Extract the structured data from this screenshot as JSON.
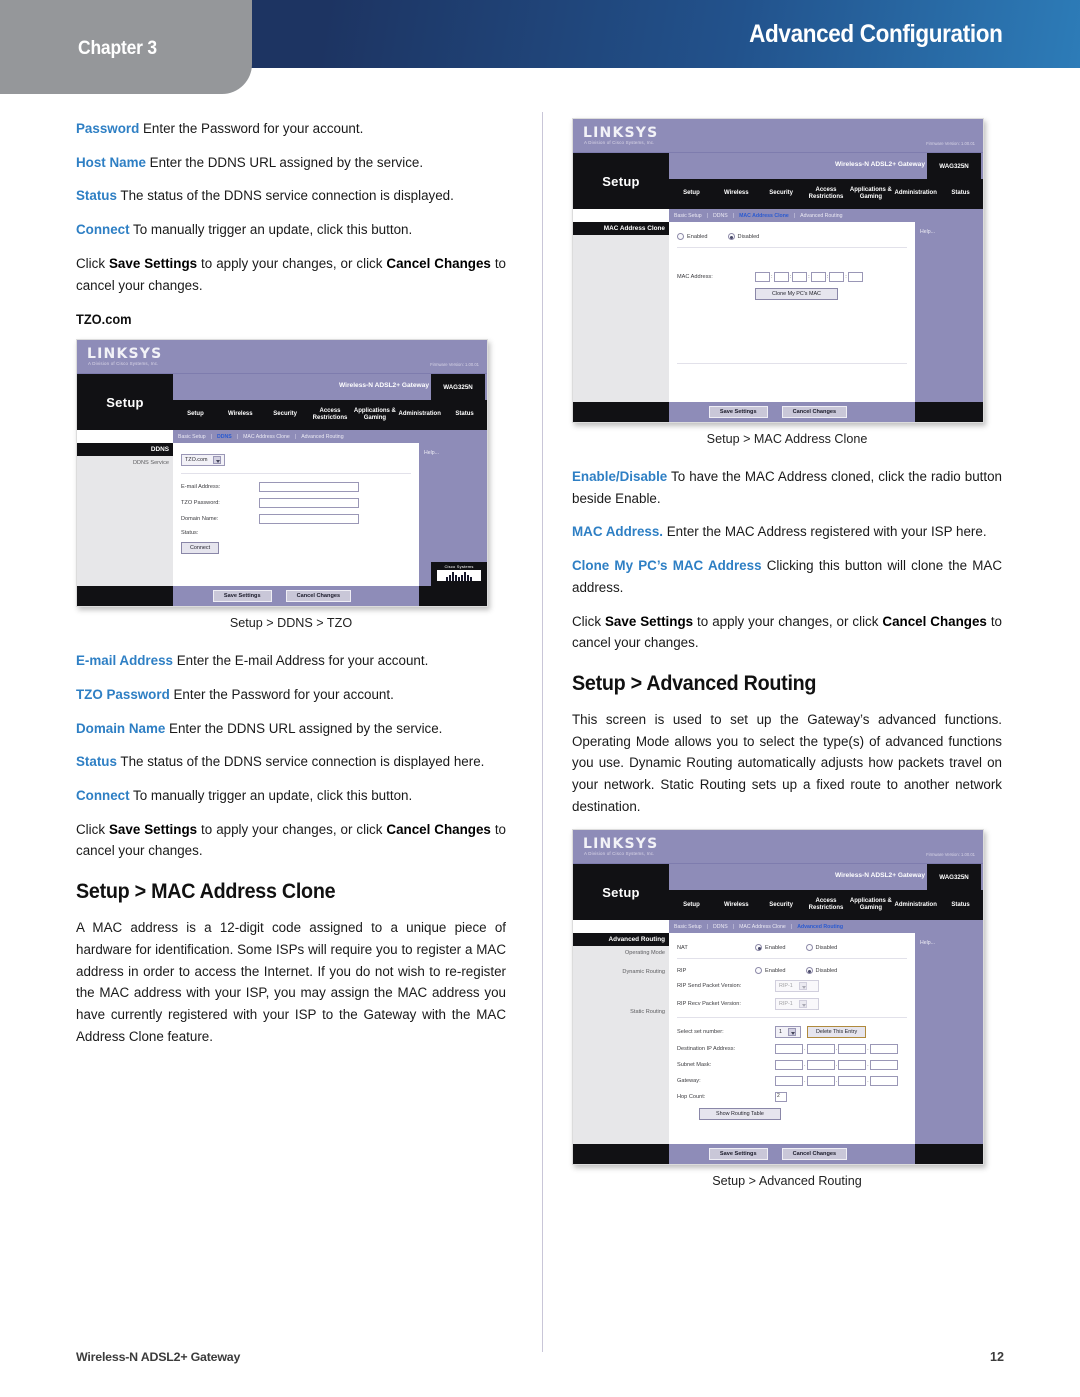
{
  "header": {
    "chapter_label": "Chapter 3",
    "title": "Advanced Configuration",
    "gray_color": "#95979a",
    "blue_dark": "#1d3462",
    "blue_light": "#2d7cb8"
  },
  "accent_color": "#2e7fc4",
  "left_column": {
    "paragraphs": [
      {
        "term": "Password",
        "text": "  Enter the Password for your account."
      },
      {
        "term": "Host Name",
        "text": "  Enter the DDNS URL assigned by the service."
      },
      {
        "term": "Status",
        "text": " The status of the DDNS service connection is displayed."
      },
      {
        "term": "Connect",
        "text": " To manually trigger an update, click this button."
      }
    ],
    "save_paragraph": {
      "pre": "Click ",
      "bold1": "Save Settings",
      "mid": " to apply your changes, or click ",
      "bold2": "Cancel Changes",
      "post": " to cancel your changes."
    },
    "subhead": "TZO.com",
    "figure1_caption": "Setup > DDNS > TZO",
    "paragraphs2": [
      {
        "term": "E-mail Address",
        "text": " Enter the E-mail Address for your account."
      },
      {
        "term": "TZO Password",
        "text": "  Enter the Password for your account."
      },
      {
        "term": "Domain Name",
        "text": " Enter the DDNS URL assigned by the service."
      },
      {
        "term": "Status",
        "text": " The status of the DDNS service connection is displayed here."
      },
      {
        "term": "Connect",
        "text": " To manually trigger an update, click this button."
      }
    ],
    "section_heading": "Setup > MAC Address Clone",
    "section_body": "A MAC address is a 12-digit code assigned to a unique piece of hardware for identification. Some ISPs will require you to register a MAC address in order to access the Internet.  If you do not wish to re-register the MAC address with your ISP, you may assign the MAC address you have currently registered with your ISP to the Gateway with the MAC Address Clone feature."
  },
  "right_column": {
    "figure2_caption": "Setup > MAC Address Clone",
    "paragraphs": [
      {
        "term": "Enable/Disable",
        "text": " To have the MAC Address cloned, click the radio button beside Enable."
      },
      {
        "term": "MAC Address.",
        "text": " Enter the MAC Address registered with your ISP here."
      },
      {
        "term": "Clone My PC’s MAC Address",
        "text": " Clicking this button will clone the MAC address."
      }
    ],
    "save_paragraph": {
      "pre": "Click ",
      "bold1": "Save Settings",
      "mid": " to apply your changes, or click ",
      "bold2": "Cancel Changes",
      "post": " to cancel your changes."
    },
    "section_heading": "Setup > Advanced Routing",
    "section_body": "This screen is used to set up the Gateway’s advanced functions. Operating Mode allows you to select the type(s) of advanced functions you use. Dynamic Routing automatically adjusts how packets travel on your network. Static Routing sets up a fixed route to another network destination.",
    "figure3_caption": "Setup > Advanced Routing"
  },
  "router_ui": {
    "brand": "LINKSYS",
    "brand_sub": "A Division of Cisco Systems, Inc.",
    "firmware": "Firmware Version: 1.00.01",
    "model_title": "Wireless-N ADSL2+ Gateway",
    "model_badge": "WAG325N",
    "left_title": "Setup",
    "nav_tabs": [
      "Setup",
      "Wireless",
      "Security",
      "Access Restrictions",
      "Applications & Gaming",
      "Administration",
      "Status"
    ],
    "subnav": [
      "Basic Setup",
      "DDNS",
      "MAC Address Clone",
      "Advanced Routing"
    ],
    "help_text": "Help...",
    "cisco_text": "Cisco Systems",
    "save_button": "Save Settings",
    "cancel_button": "Cancel Changes"
  },
  "figure_ddns": {
    "subnav_active": "DDNS",
    "sidebar_header": "DDNS",
    "sidebar_labels": [
      "DDNS Service"
    ],
    "service_value": "TZO.com",
    "fields": [
      {
        "label": "E-mail Address:",
        "value": ""
      },
      {
        "label": "TZO Password:",
        "value": ""
      },
      {
        "label": "Domain Name:",
        "value": ""
      }
    ],
    "status_label": "Status:",
    "connect_button": "Connect"
  },
  "figure_mac": {
    "subnav_active": "MAC Address Clone",
    "sidebar_header": "MAC Address Clone",
    "enabled_label": "Enabled",
    "disabled_label": "Disabled",
    "selected": "Disabled",
    "mac_label": "MAC Address:",
    "mac_octets": [
      "",
      "",
      "",
      "",
      "",
      ""
    ],
    "clone_button": "Clone My PC's MAC"
  },
  "figure_routing": {
    "subnav_active": "Advanced Routing",
    "sidebar_header": "Advanced Routing",
    "sidebar_labels": [
      "Operating Mode",
      "Dynamic Routing",
      "Static Routing"
    ],
    "nat_label": "NAT",
    "nat_enabled": "Enabled",
    "nat_disabled": "Disabled",
    "nat_selected": "Enabled",
    "rip_label": "RIP",
    "rip_enabled": "Enabled",
    "rip_disabled": "Disabled",
    "rip_selected": "Disabled",
    "rip_send_label": "RIP Send Packet Version:",
    "rip_send_value": "RIP-1",
    "rip_recv_label": "RIP Recv Packet Version:",
    "rip_recv_value": "RIP-1",
    "select_set_label": "Select set number:",
    "select_set_value": "1",
    "delete_button": "Delete This Entry",
    "dest_ip_label": "Destination IP Address:",
    "subnet_label": "Subnet Mask:",
    "gateway_label": "Gateway:",
    "hop_label": "Hop Count:",
    "hop_value": "2",
    "show_routing_button": "Show Routing Table"
  },
  "footer": {
    "left": "Wireless-N ADSL2+ Gateway",
    "page_number": "12"
  }
}
